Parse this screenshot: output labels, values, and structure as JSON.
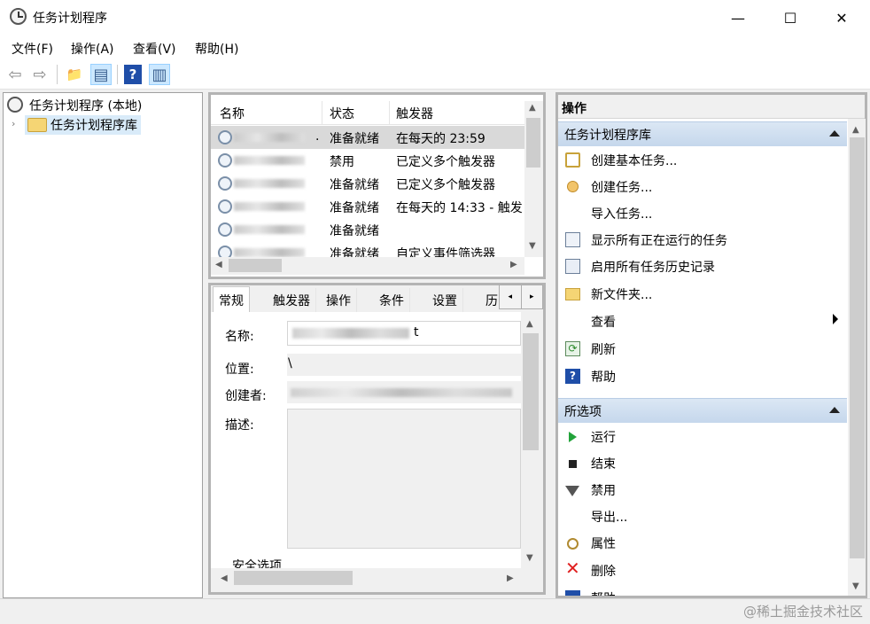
{
  "window": {
    "title": "任务计划程序",
    "minimize": "—",
    "maximize": "☐",
    "close": "✕"
  },
  "menu": [
    "文件(F)",
    "操作(A)",
    "查看(V)",
    "帮助(H)"
  ],
  "toolbar": {
    "back_icon": "⇦",
    "forward_icon": "⇨",
    "up_icon": "📁",
    "pane_icon": "▤",
    "help_icon": "?",
    "pane2_icon": "▥"
  },
  "tree": {
    "root": "任务计划程序 (本地)",
    "child": "任务计划程序库",
    "expand": "›"
  },
  "task_list": {
    "columns": [
      "名称",
      "状态",
      "触发器"
    ],
    "rows": [
      {
        "name_suffix": ".",
        "status": "准备就绪",
        "trigger": "在每天的 23:59"
      },
      {
        "name_suffix": "",
        "status": "禁用",
        "trigger": "已定义多个触发器"
      },
      {
        "name_suffix": "",
        "status": "准备就绪",
        "trigger": "已定义多个触发器"
      },
      {
        "name_suffix": "",
        "status": "准备就绪",
        "trigger": "在每天的 14:33 - 触发"
      },
      {
        "name_suffix": "",
        "status": "准备就绪",
        "trigger": ""
      },
      {
        "name_suffix": "",
        "status": "准备就绪",
        "trigger": "自定义事件筛选器"
      }
    ]
  },
  "detail": {
    "tabs": [
      "常规",
      "触发器",
      "操作",
      "条件",
      "设置",
      "历"
    ],
    "nav_left": "◂",
    "nav_right": "▸",
    "fields": {
      "name_label": "名称:",
      "name_tail": "t",
      "location_label": "位置:",
      "location_value": "\\",
      "author_label": "创建者:",
      "desc_label": "描述:"
    },
    "security_label": "安全选项"
  },
  "actions": {
    "title": "操作",
    "library_section": "任务计划程序库",
    "library_items": [
      {
        "icon": "create-basic-task-icon",
        "label": "创建基本任务..."
      },
      {
        "icon": "create-task-icon",
        "label": "创建任务..."
      },
      {
        "icon": "",
        "label": "导入任务..."
      },
      {
        "icon": "running-tasks-icon",
        "label": "显示所有正在运行的任务"
      },
      {
        "icon": "history-icon",
        "label": "启用所有任务历史记录"
      },
      {
        "icon": "new-folder-icon",
        "label": "新文件夹..."
      },
      {
        "icon": "",
        "label": "查看"
      },
      {
        "icon": "refresh-icon",
        "label": "刷新"
      },
      {
        "icon": "help-icon",
        "label": "帮助"
      }
    ],
    "selected_section": "所选项",
    "selected_items": [
      {
        "icon": "run-icon",
        "label": "运行"
      },
      {
        "icon": "end-icon",
        "label": "结束"
      },
      {
        "icon": "disable-icon",
        "label": "禁用"
      },
      {
        "icon": "",
        "label": "导出..."
      },
      {
        "icon": "properties-icon",
        "label": "属性"
      },
      {
        "icon": "delete-icon",
        "label": "删除"
      },
      {
        "icon": "help-icon",
        "label": "帮助"
      }
    ]
  },
  "watermark": "@稀土掘金技术社区"
}
